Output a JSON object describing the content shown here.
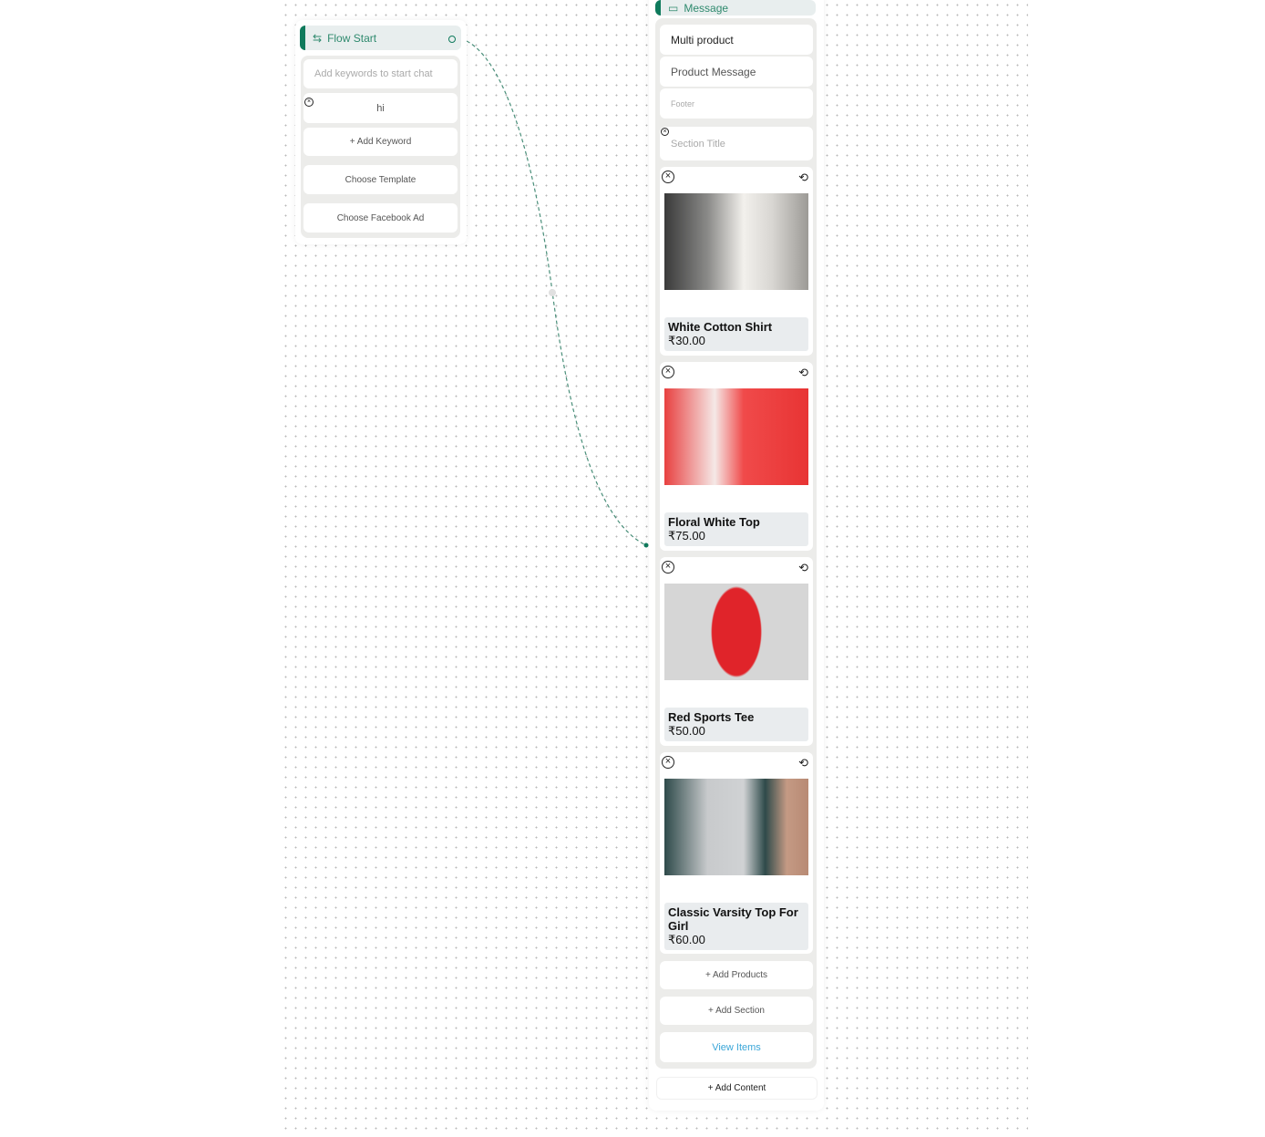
{
  "flow_start": {
    "title": "Flow Start",
    "keywords_placeholder": "Add keywords to start chat",
    "keyword": "hi",
    "add_keyword": "+ Add Keyword",
    "choose_template": "Choose Template",
    "choose_facebook_ad": "Choose Facebook Ad"
  },
  "message": {
    "title": "Message",
    "type": "Multi product",
    "body": "Product Message",
    "footer_placeholder": "Footer",
    "section_title_placeholder": "Section Title",
    "products": [
      {
        "name": "White Cotton Shirt",
        "price": "₹30.00"
      },
      {
        "name": "Floral White Top",
        "price": "₹75.00"
      },
      {
        "name": "Red Sports Tee",
        "price": "₹50.00"
      },
      {
        "name": "Classic Varsity Top For Girl",
        "price": "₹60.00"
      }
    ],
    "add_products": "+ Add Products",
    "add_section": "+ Add Section",
    "view_items": "View Items",
    "add_content": "+ Add Content"
  },
  "colors": {
    "accent": "#0f7a5c",
    "link": "#3aa6d8"
  }
}
